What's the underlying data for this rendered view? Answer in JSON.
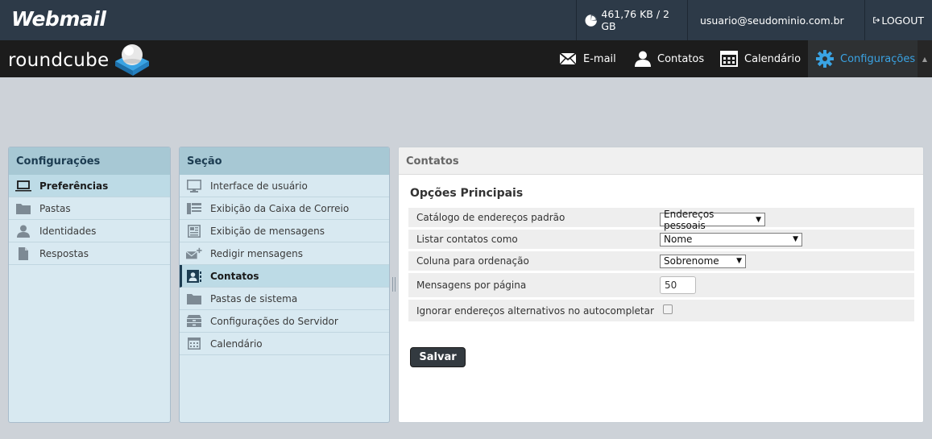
{
  "topbar": {
    "logo": "Webmail",
    "quota": "461,76 KB / 2 GB",
    "user": "usuario@seudominio.com.br",
    "logout": "LOGOUT"
  },
  "navbar": {
    "logo": "roundcube",
    "items": [
      {
        "label": "E-mail",
        "icon": "envelope-icon"
      },
      {
        "label": "Contatos",
        "icon": "person-icon"
      },
      {
        "label": "Calendário",
        "icon": "calendar-icon"
      },
      {
        "label": "Configurações",
        "icon": "gear-icon",
        "active": true
      }
    ],
    "active_color": "#3aa3e3"
  },
  "settings_panel": {
    "header": "Configurações",
    "items": [
      {
        "label": "Preferências",
        "icon": "laptop-icon",
        "selected": true
      },
      {
        "label": "Pastas",
        "icon": "folder-icon"
      },
      {
        "label": "Identidades",
        "icon": "identity-icon"
      },
      {
        "label": "Respostas",
        "icon": "document-icon"
      }
    ]
  },
  "section_panel": {
    "header": "Seção",
    "items": [
      {
        "label": "Interface de usuário",
        "icon": "monitor-icon"
      },
      {
        "label": "Exibição da Caixa de Correio",
        "icon": "mailbox-view-icon"
      },
      {
        "label": "Exibição de mensagens",
        "icon": "message-view-icon"
      },
      {
        "label": "Redigir mensagens",
        "icon": "compose-icon"
      },
      {
        "label": "Contatos",
        "icon": "contacts-icon",
        "selected": true
      },
      {
        "label": "Pastas de sistema",
        "icon": "folder-icon"
      },
      {
        "label": "Configurações do Servidor",
        "icon": "server-icon"
      },
      {
        "label": "Calendário",
        "icon": "calendar-icon"
      }
    ]
  },
  "content": {
    "header": "Contatos",
    "title": "Opções Principais",
    "options": [
      {
        "label": "Catálogo de endereços padrão",
        "type": "select",
        "value": "Endereços pessoais"
      },
      {
        "label": "Listar contatos como",
        "type": "select",
        "value": "Nome"
      },
      {
        "label": "Coluna para ordenação",
        "type": "select",
        "value": "Sobrenome"
      },
      {
        "label": "Mensagens por página",
        "type": "text",
        "value": "50"
      },
      {
        "label": "Ignorar endereços alternativos no autocompletar",
        "type": "checkbox",
        "checked": false
      }
    ],
    "save_label": "Salvar"
  }
}
